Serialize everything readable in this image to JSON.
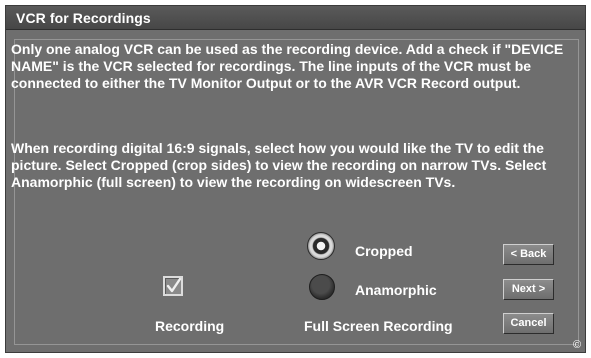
{
  "window": {
    "title": "VCR for Recordings"
  },
  "instructions": {
    "paragraph1": "Only one analog VCR can be used as the recording device.  Add a check if \"DEVICE NAME\" is the VCR selected for recordings.  The line inputs of the VCR must be connected to either the TV Monitor Output or to the AVR VCR Record output.",
    "paragraph2": "When recording digital 16:9 signals, select how you would like the TV to edit the picture.  Select Cropped (crop sides) to view the recording on narrow TVs.  Select Anamorphic (full screen) to view the recording on widescreen TVs."
  },
  "recording": {
    "checkbox_label": "Recording",
    "checked": true
  },
  "full_screen_recording": {
    "group_label": "Full Screen Recording",
    "options": [
      {
        "label": "Cropped",
        "selected": true
      },
      {
        "label": "Anamorphic",
        "selected": false
      }
    ]
  },
  "buttons": {
    "back": "< Back",
    "next": "Next >",
    "cancel": "Cancel"
  },
  "footer": {
    "copyright_mark": "©"
  }
}
